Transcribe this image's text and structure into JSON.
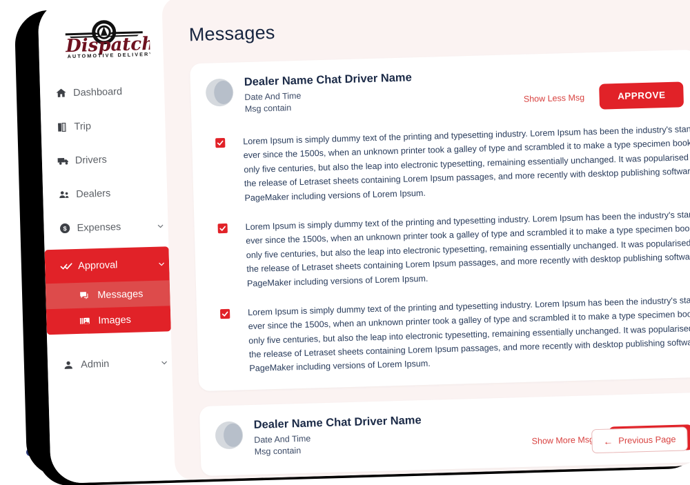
{
  "brand": {
    "name": "Dispatch",
    "tagline": "AUTOMOTIVE DELIVERY"
  },
  "colors": {
    "primary_red": "#e12228",
    "sub_active_red": "#dd4b4b",
    "link_red": "#d8413f",
    "title_navy": "#172540",
    "content_bg": "#fbf3f2",
    "dot_navy": "#2b3a7a"
  },
  "sidebar": {
    "items": [
      {
        "label": "Dashboard",
        "icon": "home-icon",
        "expandable": false
      },
      {
        "label": "Trip",
        "icon": "map-icon",
        "expandable": false
      },
      {
        "label": "Drivers",
        "icon": "truck-icon",
        "expandable": false
      },
      {
        "label": "Dealers",
        "icon": "people-icon",
        "expandable": false
      },
      {
        "label": "Expenses",
        "icon": "dollar-circle-icon",
        "expandable": true
      },
      {
        "label": "Approval",
        "icon": "double-check-icon",
        "expandable": true
      },
      {
        "label": "Admin",
        "icon": "person-icon",
        "expandable": true
      }
    ],
    "approval_children": [
      {
        "label": "Messages",
        "icon": "chat-icon",
        "active": true
      },
      {
        "label": "Images",
        "icon": "image-icon",
        "active": false
      }
    ]
  },
  "main": {
    "title": "Messages",
    "approve_label": "APPROVE",
    "pagination": {
      "previous_label": "Previous Page",
      "arrow": "←"
    },
    "body_text": "Lorem Ipsum is simply dummy text of the printing and typesetting industry. Lorem Ipsum has been the industry's standard dummy text ever since the 1500s, when an unknown printer took a galley of type and scrambled it to make a type specimen book. It has survived not only five centuries, but also the leap into electronic typesetting, remaining essentially unchanged. It was popularised in the 1960s with the release of Letraset sheets containing Lorem Ipsum passages, and more recently with desktop publishing software like Aldus PageMaker including versions of Lorem Ipsum.",
    "cards": [
      {
        "title": "Dealer Name Chat Driver Name",
        "date": "Date And Time",
        "subtitle": "Msg contain",
        "toggle_label": "Show Less Msg",
        "expanded": true,
        "messages": [
          {
            "checked": true
          },
          {
            "checked": true
          },
          {
            "checked": true
          }
        ]
      },
      {
        "title": "Dealer Name Chat Driver Name",
        "date": "Date And Time",
        "subtitle": "Msg contain",
        "toggle_label": "Show More Msg",
        "expanded": false,
        "messages": []
      }
    ]
  }
}
